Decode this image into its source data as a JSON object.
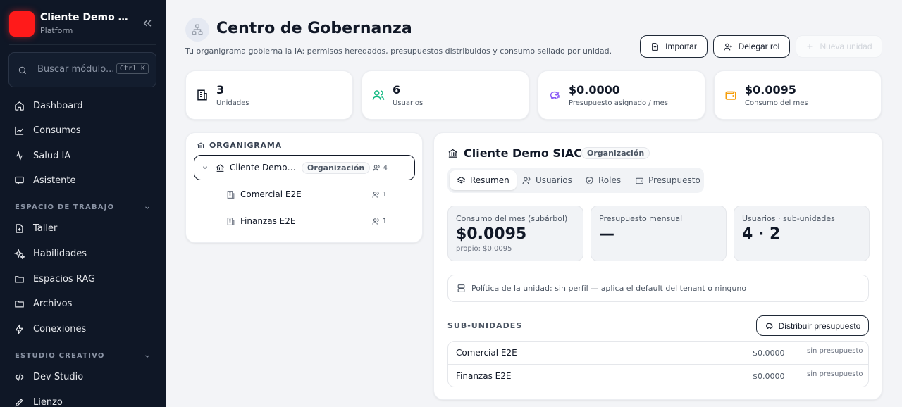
{
  "brand": {
    "name": "Cliente Demo SIAC",
    "subtitle": "Platform"
  },
  "search": {
    "placeholder": "Buscar módulo...",
    "shortcut": "Ctrl K"
  },
  "nav": {
    "main": [
      {
        "label": "Dashboard",
        "icon": "home-icon"
      },
      {
        "label": "Consumos",
        "icon": "line-chart-icon"
      },
      {
        "label": "Salud IA",
        "icon": "activity-icon"
      },
      {
        "label": "Asistente",
        "icon": "chat-icon"
      }
    ],
    "workspace_label": "ESPACIO DE TRABAJO",
    "workspace": [
      {
        "label": "Taller",
        "icon": "file-plus-icon"
      },
      {
        "label": "Habilidades",
        "icon": "sparkles-icon"
      },
      {
        "label": "Espacios RAG",
        "icon": "folder-icon"
      },
      {
        "label": "Archivos",
        "icon": "folder-icon"
      },
      {
        "label": "Conexiones",
        "icon": "zap-icon"
      }
    ],
    "creative_label": "ESTUDIO CREATIVO",
    "creative": [
      {
        "label": "Dev Studio",
        "icon": "code-icon"
      },
      {
        "label": "Lienzo",
        "icon": "pen-icon"
      }
    ]
  },
  "header": {
    "title": "Centro de Gobernanza",
    "subtitle": "Tu organigrama gobierna la IA: permisos heredados, presupuestos distribuidos y consumo sellado por unidad.",
    "import_label": "Importar",
    "delegate_label": "Delegar rol",
    "new_unit_label": "Nueva unidad"
  },
  "stats": [
    {
      "value": "3",
      "label": "Unidades",
      "color": "#111827"
    },
    {
      "value": "6",
      "label": "Usuarios",
      "color": "#10b981"
    },
    {
      "value": "$0.0000",
      "label": "Presupuesto asignado / mes",
      "color": "#8b5cf6"
    },
    {
      "value": "$0.0095",
      "label": "Consumo del mes",
      "color": "#f59e0b"
    }
  ],
  "org": {
    "title": "ORGANIGRAMA",
    "root": {
      "name": "Cliente Demo SIAC",
      "badge": "Organización",
      "count": "4"
    },
    "children": [
      {
        "name": "Comercial E2E",
        "count": "1"
      },
      {
        "name": "Finanzas E2E",
        "count": "1"
      }
    ]
  },
  "detail": {
    "title": "Cliente Demo SIAC",
    "badge": "Organización",
    "tabs": [
      "Resumen",
      "Usuarios",
      "Roles",
      "Presupuesto"
    ],
    "metrics": [
      {
        "label": "Consumo del mes (subárbol)",
        "value": "$0.0095",
        "sub": "propio: $0.0095"
      },
      {
        "label": "Presupuesto mensual",
        "value": "—",
        "sub": ""
      },
      {
        "label": "Usuarios · sub-unidades",
        "value": "4 · 2",
        "sub": ""
      }
    ],
    "policy": "Política de la unidad: sin perfil — aplica el default del tenant o ninguno",
    "subunits_title": "SUB-UNIDADES",
    "distribute_label": "Distribuir presupuesto",
    "subunits": [
      {
        "name": "Comercial E2E",
        "amount": "$0.0000",
        "status": "sin presupuesto"
      },
      {
        "name": "Finanzas E2E",
        "amount": "$0.0000",
        "status": "sin presupuesto"
      }
    ]
  }
}
